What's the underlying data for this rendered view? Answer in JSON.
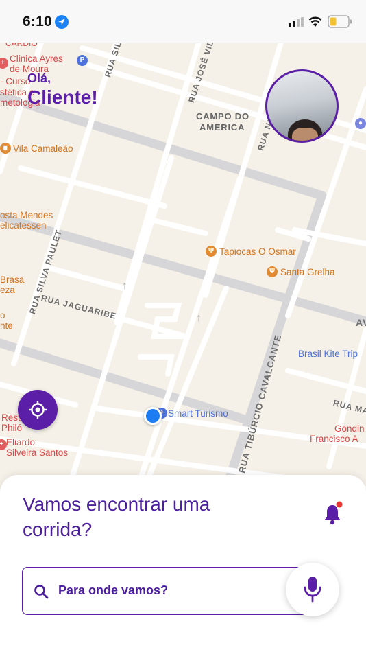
{
  "status_bar": {
    "time": "6:10"
  },
  "greeting": {
    "line1": "Olá,",
    "line2": "Cliente!"
  },
  "map": {
    "area_label_1": "CAMPO DO",
    "area_label_2": "AMERICA",
    "places": {
      "clinica_1": "Clinica Ayres",
      "clinica_2": "de Moura",
      "curso": "- Curso",
      "estetica": "stética e",
      "cosmetologia": "metologia",
      "cardio": "CARDIO",
      "vila": "Vila Camaleão",
      "costa_1": "osta Mendes",
      "costa_2": "elicatessen",
      "tapiocas": "Tapiocas O Osmar",
      "santa": "Santa Grelha",
      "brasa_1": "Brasa",
      "brasa_2": "eza",
      "ponto_1": "o",
      "ponto_2": "nte",
      "brasil_kite": "Brasil Kite Trip",
      "smart": "Smart Turismo",
      "gondim_1": "Gondin",
      "gondim_2": "Francisco A",
      "resto_1": "Resta",
      "resto_2": "Philó",
      "eliardo_1": "Eliardo",
      "eliardo_2": "Silveira Santos"
    },
    "streets": {
      "silva": "RUA SILV",
      "jose_vila": "RUA JOSÉ VILA",
      "nunes": "RUA NUNES",
      "silva_paulet": "RUA SILVA PAULET",
      "jaguaribe": "RUA JAGUARIBE",
      "tiburcio": "RUA TIBÚRCIO CAVALCANTE",
      "rua_ma": "RUA MA",
      "av": "AV"
    }
  },
  "sheet": {
    "title": "Vamos encontrar uma corrida?",
    "search_placeholder": "Para onde vamos?"
  },
  "colors": {
    "brand": "#5b1ea6",
    "brand_text": "#4b1e9c",
    "user_location": "#1d7cf2",
    "notification_dot": "#e53935"
  },
  "icons": {
    "locate": "crosshair-icon",
    "notification": "bell-icon",
    "search": "search-icon",
    "voice": "microphone-icon"
  }
}
